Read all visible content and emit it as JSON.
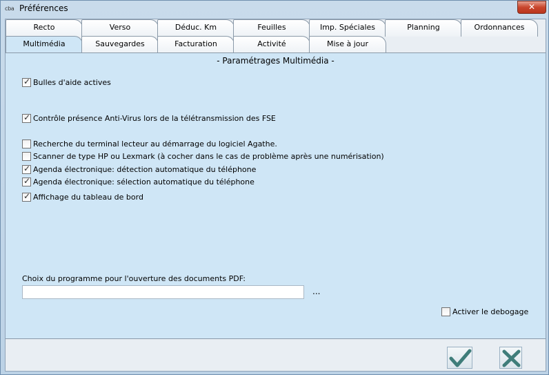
{
  "window": {
    "icon_text": "cba",
    "title": "Préférences",
    "close_glyph": "✕"
  },
  "tabs_row1": [
    "Recto",
    "Verso",
    "Déduc. Km",
    "Feuilles",
    "Imp. Spéciales",
    "Planning",
    "Ordonnances"
  ],
  "tabs_row2": [
    "Multimédia",
    "Sauvegardes",
    "Facturation",
    "Activité",
    "Mise à jour"
  ],
  "active_tab": "Multimédia",
  "panel": {
    "title": "- Paramétrages Multimédia -",
    "options": [
      {
        "label": "Bulles d'aide actives",
        "checked": true
      },
      {
        "label": "Contrôle présence Anti-Virus lors de la télétransmission des FSE",
        "checked": true
      },
      {
        "label": "Recherche du terminal lecteur au démarrage du logiciel Agathe.",
        "checked": false
      },
      {
        "label": "Scanner de type HP ou Lexmark (à cocher dans le cas de problème après une numérisation)",
        "checked": false
      },
      {
        "label": "Agenda électronique: détection automatique du téléphone",
        "checked": true
      },
      {
        "label": "Agenda électronique: sélection automatique du téléphone",
        "checked": true
      },
      {
        "label": "Affichage du tableau de bord",
        "checked": true
      }
    ],
    "pdf": {
      "label": "Choix du programme pour l'ouverture des documents PDF:",
      "value": "",
      "browse": "..."
    },
    "debug": {
      "label": "Activer le debogage",
      "checked": false
    }
  },
  "buttons": {
    "ok_icon": "check-icon",
    "cancel_icon": "cross-icon"
  },
  "colors": {
    "panel": "#cfe6f6",
    "ok": "#3f7d7a",
    "cancel": "#3f7d7a"
  }
}
